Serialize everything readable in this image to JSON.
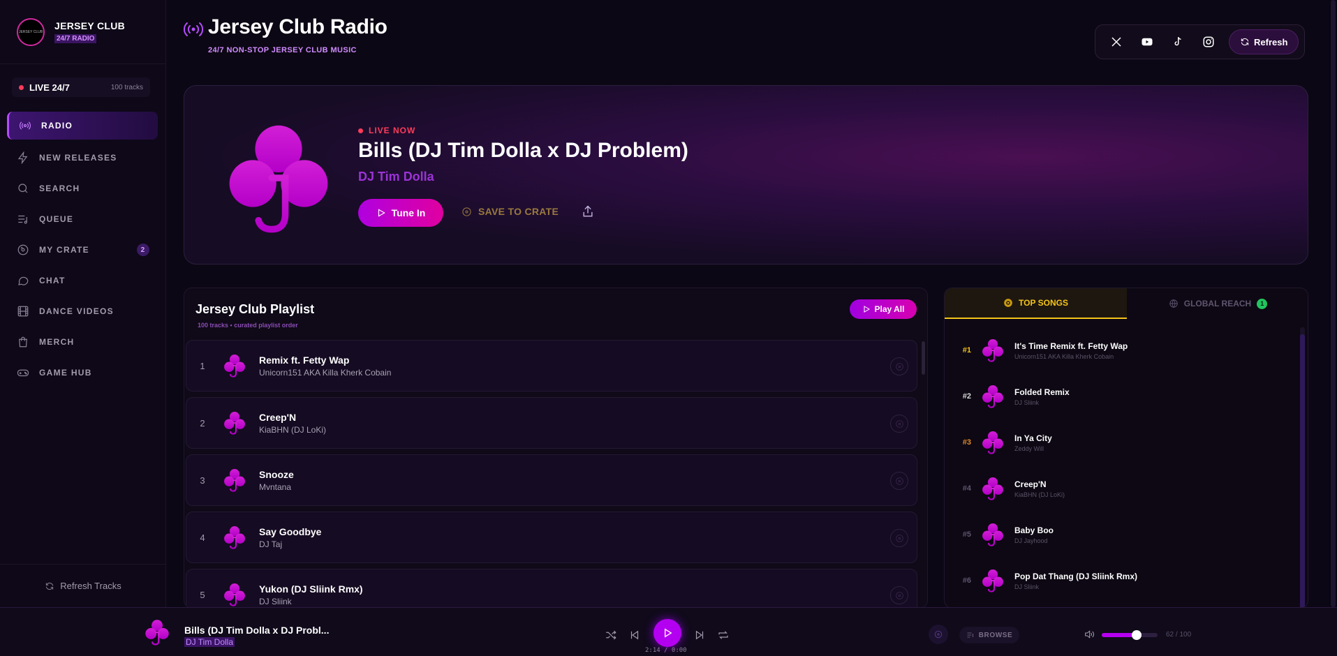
{
  "brand": {
    "title": "JERSEY CLUB",
    "subtitle": "24/7 RADIO"
  },
  "live": {
    "label": "LIVE 24/7",
    "count": "100 tracks"
  },
  "nav": [
    {
      "label": "RADIO",
      "icon": "radio-icon",
      "active": true
    },
    {
      "label": "NEW RELEASES",
      "icon": "lightning-icon"
    },
    {
      "label": "SEARCH",
      "icon": "search-icon"
    },
    {
      "label": "QUEUE",
      "icon": "queue-icon"
    },
    {
      "label": "MY CRATE",
      "icon": "vinyl-icon",
      "badge": "2"
    },
    {
      "label": "CHAT",
      "icon": "chat-icon"
    },
    {
      "label": "DANCE VIDEOS",
      "icon": "film-icon"
    },
    {
      "label": "MERCH",
      "icon": "bag-icon"
    },
    {
      "label": "GAME HUB",
      "icon": "gamepad-icon"
    }
  ],
  "sidebar_footer": {
    "refresh_label": "Refresh Tracks"
  },
  "header": {
    "title": "Jersey Club Radio",
    "subtitle": "24/7 NON-STOP JERSEY CLUB MUSIC",
    "refresh_label": "Refresh"
  },
  "social": [
    "x-icon",
    "youtube-icon",
    "tiktok-icon",
    "instagram-icon"
  ],
  "hero": {
    "status": "LIVE NOW",
    "title": "Bills (DJ Tim Dolla x DJ Problem)",
    "artist": "DJ Tim Dolla",
    "tune_in_label": "Tune In",
    "save_label": "SAVE TO CRATE"
  },
  "playlist": {
    "title": "Jersey Club Playlist",
    "subtitle": "100 tracks • curated playlist order",
    "play_all_label": "Play All",
    "rows": [
      {
        "num": "1",
        "title": "Remix ft. Fetty Wap",
        "artist": "Unicorn151 AKA Killa Kherk Cobain"
      },
      {
        "num": "2",
        "title": "Creep'N",
        "artist": "KiaBHN (DJ LoKi)"
      },
      {
        "num": "3",
        "title": "Snooze",
        "artist": "Mvntana"
      },
      {
        "num": "4",
        "title": "Say Goodbye",
        "artist": "DJ Taj"
      },
      {
        "num": "5",
        "title": "Yukon (DJ Sliink Rmx)",
        "artist": "DJ Sliink"
      }
    ]
  },
  "top": {
    "tab_top": "TOP SONGS",
    "tab_global": "GLOBAL REACH",
    "global_badge": "1",
    "items": [
      {
        "rank": "#1",
        "title": "It's Time Remix ft. Fetty Wap",
        "artist": "Unicorn151 AKA Killa Kherk Cobain",
        "color": "#f5c518"
      },
      {
        "rank": "#2",
        "title": "Folded Remix",
        "artist": "DJ Sliink",
        "color": "#d9d9d9"
      },
      {
        "rank": "#3",
        "title": "In Ya City",
        "artist": "Zeddy Will",
        "color": "#e08a2a"
      },
      {
        "rank": "#4",
        "title": "Creep'N",
        "artist": "KiaBHN (DJ LoKi)",
        "color": "#5f5570"
      },
      {
        "rank": "#5",
        "title": "Baby Boo",
        "artist": "DJ Jayhood",
        "color": "#5f5570"
      },
      {
        "rank": "#6",
        "title": "Pop Dat Thang (DJ Sliink Rmx)",
        "artist": "DJ Sliink",
        "color": "#5f5570"
      }
    ]
  },
  "player": {
    "title": "Bills (DJ Tim Dolla x DJ Probl...",
    "artist": "DJ Tim Dolla",
    "time": "2:14 / 0:00",
    "browse_label": "BROWSE",
    "volume": 62,
    "volume_text": "62 / 100"
  },
  "colors": {
    "accent": "#b400f0",
    "magenta": "#e000a0",
    "gold": "#f5c518",
    "live": "#ff3b5a"
  }
}
